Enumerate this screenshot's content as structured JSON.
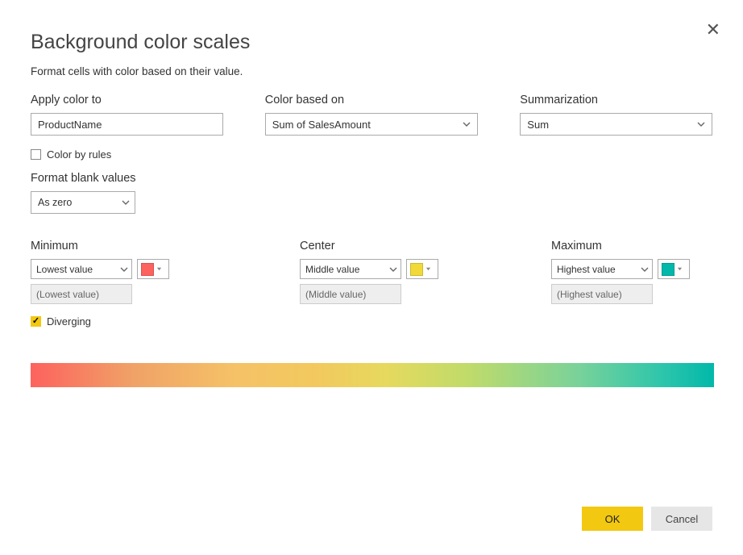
{
  "dialog": {
    "title": "Background color scales",
    "subtitle": "Format cells with color based on their value.",
    "close_glyph": "✕"
  },
  "fields": {
    "apply_color_to": {
      "label": "Apply color to",
      "value": "ProductName"
    },
    "color_based_on": {
      "label": "Color based on",
      "value": "Sum of SalesAmount"
    },
    "summarization": {
      "label": "Summarization",
      "value": "Sum"
    }
  },
  "color_by_rules": {
    "label": "Color by rules",
    "checked": false
  },
  "format_blank": {
    "label": "Format blank values",
    "value": "As zero"
  },
  "scales": {
    "min": {
      "label": "Minimum",
      "mode": "Lowest value",
      "readout": "(Lowest value)",
      "color": "#FD625E"
    },
    "center": {
      "label": "Center",
      "mode": "Middle value",
      "readout": "(Middle value)",
      "color": "#F2D93A"
    },
    "max": {
      "label": "Maximum",
      "mode": "Highest value",
      "readout": "(Highest value)",
      "color": "#01B8AA"
    }
  },
  "diverging": {
    "label": "Diverging",
    "checked": true
  },
  "buttons": {
    "ok": "OK",
    "cancel": "Cancel"
  }
}
